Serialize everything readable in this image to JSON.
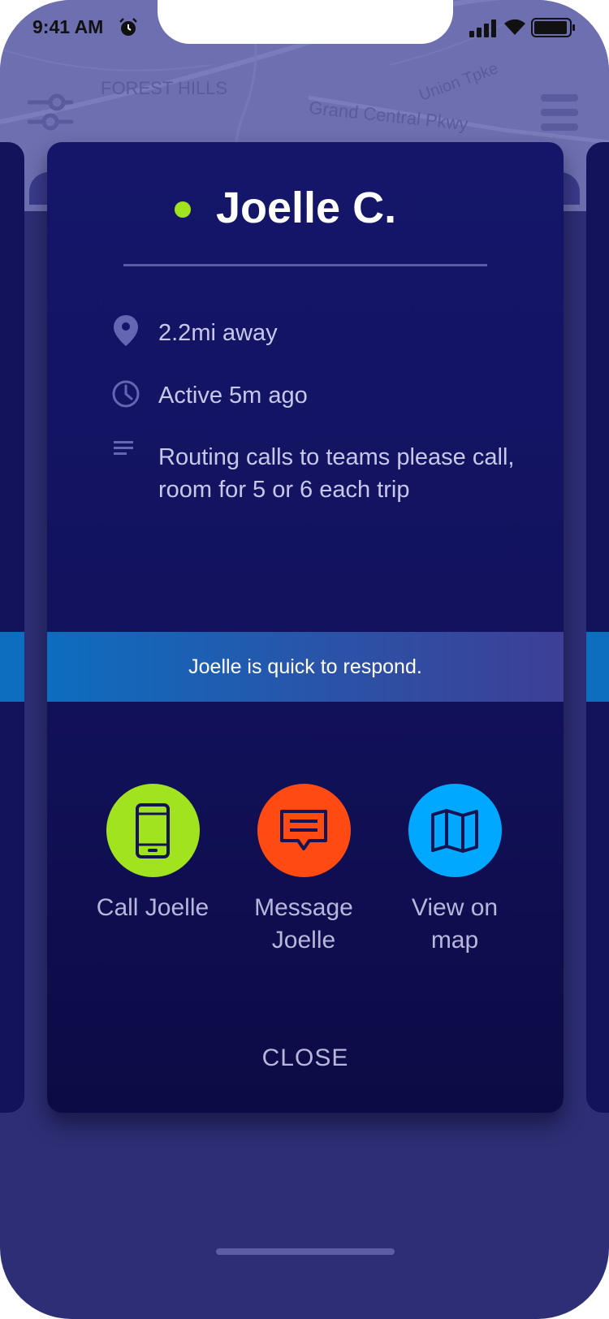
{
  "status_bar": {
    "time": "9:41 AM"
  },
  "map": {
    "labels": {
      "neighborhood": "FOREST HILLS",
      "road1": "Grand Central Pkwy",
      "road2": "Union Tpke"
    }
  },
  "contact": {
    "name": "Joelle C.",
    "status_color": "#a2e31f",
    "distance": "2.2mi away",
    "last_active": "Active 5m ago",
    "note": "Routing calls to teams please call, room for 5 or 6 each trip",
    "response_banner": "Joelle is quick to respond."
  },
  "actions": {
    "call": {
      "label": "Call Joelle",
      "color": "#a2e31f",
      "icon": "phone-icon"
    },
    "message": {
      "label": "Message Joelle",
      "color": "#ff4a12",
      "icon": "message-icon"
    },
    "map": {
      "label": "View on map",
      "color": "#00a8ff",
      "icon": "map-icon"
    }
  },
  "close_label": "CLOSE",
  "colors": {
    "background": "#2d2e75",
    "card": "#12135a",
    "banner": "#0d6dbf",
    "accent_green": "#a2e31f",
    "accent_orange": "#ff4a12",
    "accent_blue": "#00a8ff"
  }
}
